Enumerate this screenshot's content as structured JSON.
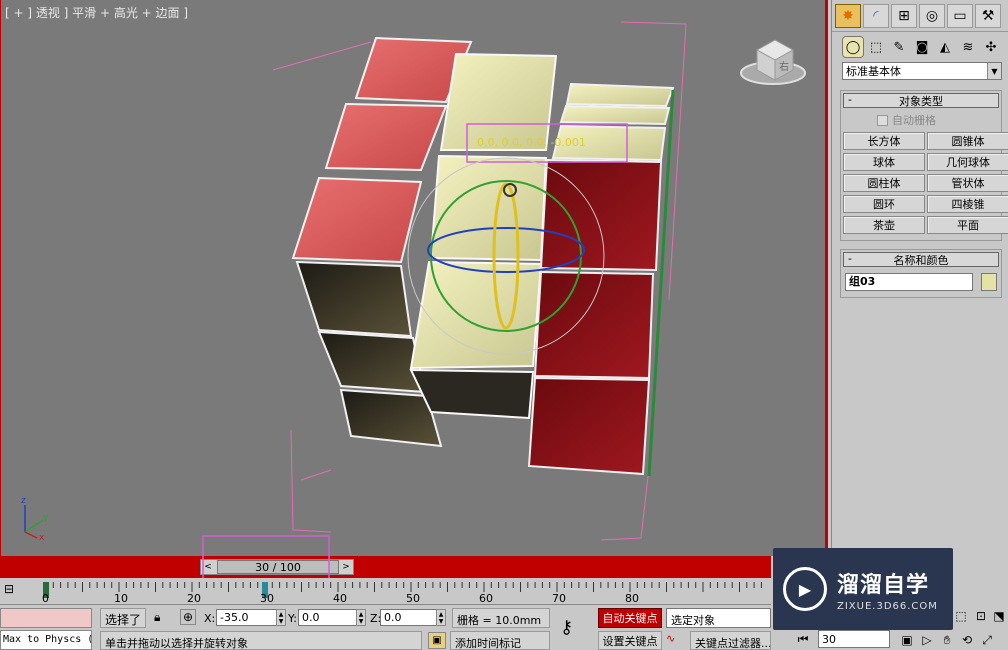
{
  "viewport": {
    "label": "[ + ] 透视 ] 平滑 + 高光 + 边面 ]",
    "gizmo_readout": "0.0, 0.0, 0.0, -0.001",
    "viewcube_label": "右",
    "axis_labels": {
      "x": "x",
      "y": "y",
      "z": "z"
    }
  },
  "command_panel": {
    "tabs": [
      "create-tab",
      "modify-tab",
      "hierarchy-tab",
      "motion-tab",
      "display-tab",
      "utilities-tab"
    ],
    "subtabs": [
      "geometry",
      "shapes",
      "lights",
      "cameras",
      "helpers",
      "space-warps",
      "systems"
    ],
    "category": "标准基本体",
    "object_type": {
      "title": "对象类型",
      "autogrid": "自动栅格",
      "buttons": [
        "长方体",
        "圆锥体",
        "球体",
        "几何球体",
        "圆柱体",
        "管状体",
        "圆环",
        "四棱锥",
        "茶壶",
        "平面"
      ]
    },
    "name_color": {
      "title": "名称和颜色",
      "name": "组03",
      "color": "#e4e2a4"
    }
  },
  "timeslider": {
    "label": "30 / 100",
    "left_arrow": "<",
    "right_arrow": ">",
    "current": 30,
    "total": 100
  },
  "trackbar": {
    "ticks": [
      "0",
      "10",
      "20",
      "30",
      "40",
      "50",
      "60",
      "70",
      "80"
    ]
  },
  "status": {
    "maxscript": "Max to Physcs (",
    "selection": "选择了",
    "x_label": "X:",
    "x_value": "-35.0",
    "y_label": "Y:",
    "y_value": "0.0",
    "z_label": "Z:",
    "z_value": "0.0",
    "grid": "栅格 = 10.0mm",
    "prompt": "单击并拖动以选择并旋转对象",
    "add_time_tag": "添加时间标记",
    "auto_key": "自动关键点",
    "set_key": "设置关键点",
    "selected_object": "选定对象",
    "key_filters": "关键点过滤器...",
    "frame": "30"
  },
  "watermark": {
    "title": "溜溜自学",
    "subtitle": "ZIXUE.3D66.COM"
  }
}
